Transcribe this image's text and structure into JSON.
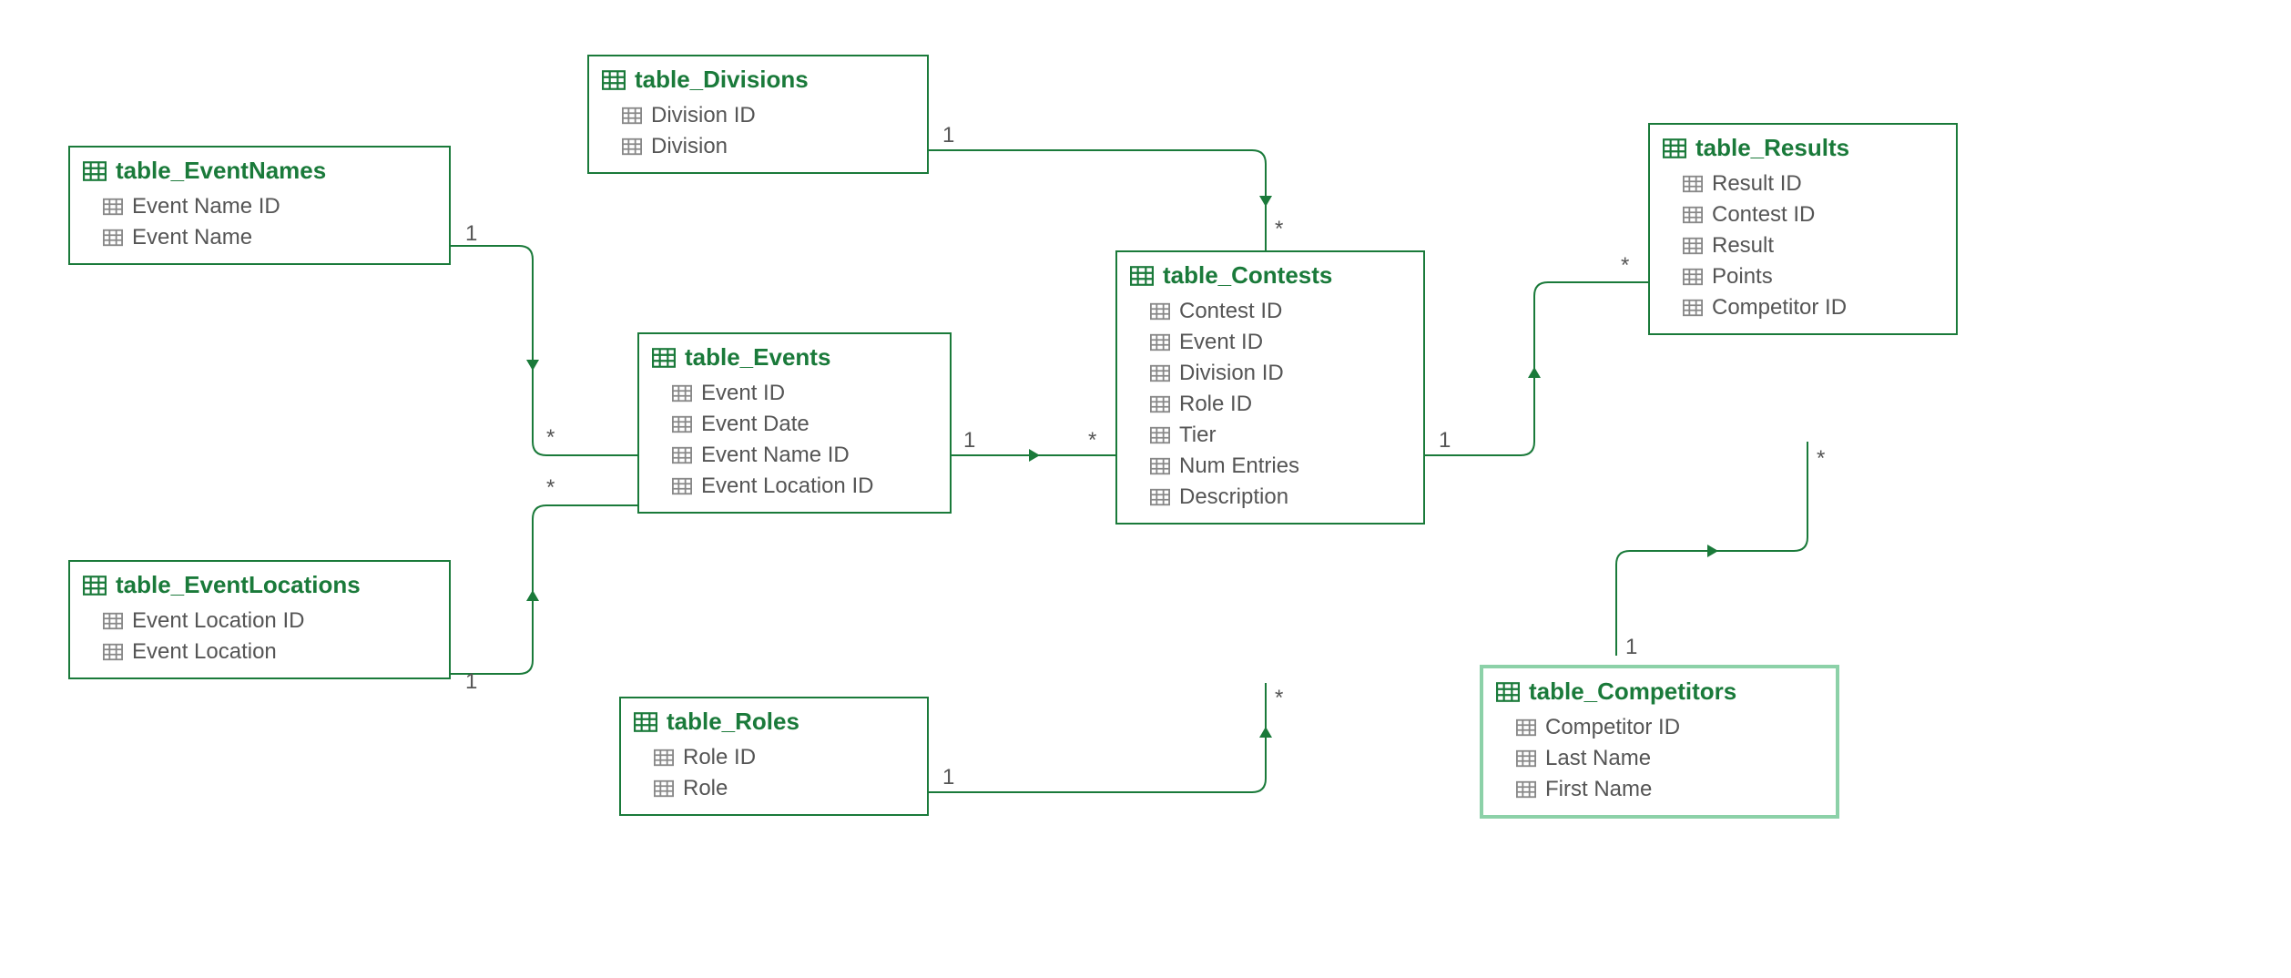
{
  "colors": {
    "border": "#1a7a3a",
    "selected": "#8cd1a8",
    "text": "#555555"
  },
  "entities": {
    "event_names": {
      "title": "table_EventNames",
      "fields": [
        "Event Name ID",
        "Event Name"
      ]
    },
    "event_locations": {
      "title": "table_EventLocations",
      "fields": [
        "Event Location ID",
        "Event Location"
      ]
    },
    "divisions": {
      "title": "table_Divisions",
      "fields": [
        "Division ID",
        "Division"
      ]
    },
    "events": {
      "title": "table_Events",
      "fields": [
        "Event ID",
        "Event Date",
        "Event Name ID",
        "Event Location ID"
      ]
    },
    "roles": {
      "title": "table_Roles",
      "fields": [
        "Role ID",
        "Role"
      ]
    },
    "contests": {
      "title": "table_Contests",
      "fields": [
        "Contest ID",
        "Event ID",
        "Division ID",
        "Role ID",
        "Tier",
        "Num Entries",
        "Description"
      ]
    },
    "results": {
      "title": "table_Results",
      "fields": [
        "Result ID",
        "Contest ID",
        "Result",
        "Points",
        "Competitor ID"
      ]
    },
    "competitors": {
      "title": "table_Competitors",
      "fields": [
        "Competitor ID",
        "Last Name",
        "First Name"
      ]
    }
  },
  "relationships": [
    {
      "from": "event_names",
      "to": "events",
      "from_card": "1",
      "to_card": "*"
    },
    {
      "from": "event_locations",
      "to": "events",
      "from_card": "1",
      "to_card": "*"
    },
    {
      "from": "divisions",
      "to": "contests",
      "from_card": "1",
      "to_card": "*"
    },
    {
      "from": "events",
      "to": "contests",
      "from_card": "1",
      "to_card": "*"
    },
    {
      "from": "roles",
      "to": "contests",
      "from_card": "1",
      "to_card": "*"
    },
    {
      "from": "contests",
      "to": "results",
      "from_card": "1",
      "to_card": "*"
    },
    {
      "from": "competitors",
      "to": "results",
      "from_card": "1",
      "to_card": "*"
    }
  ],
  "cardinality_labels": {
    "one": "1",
    "many": "*"
  }
}
